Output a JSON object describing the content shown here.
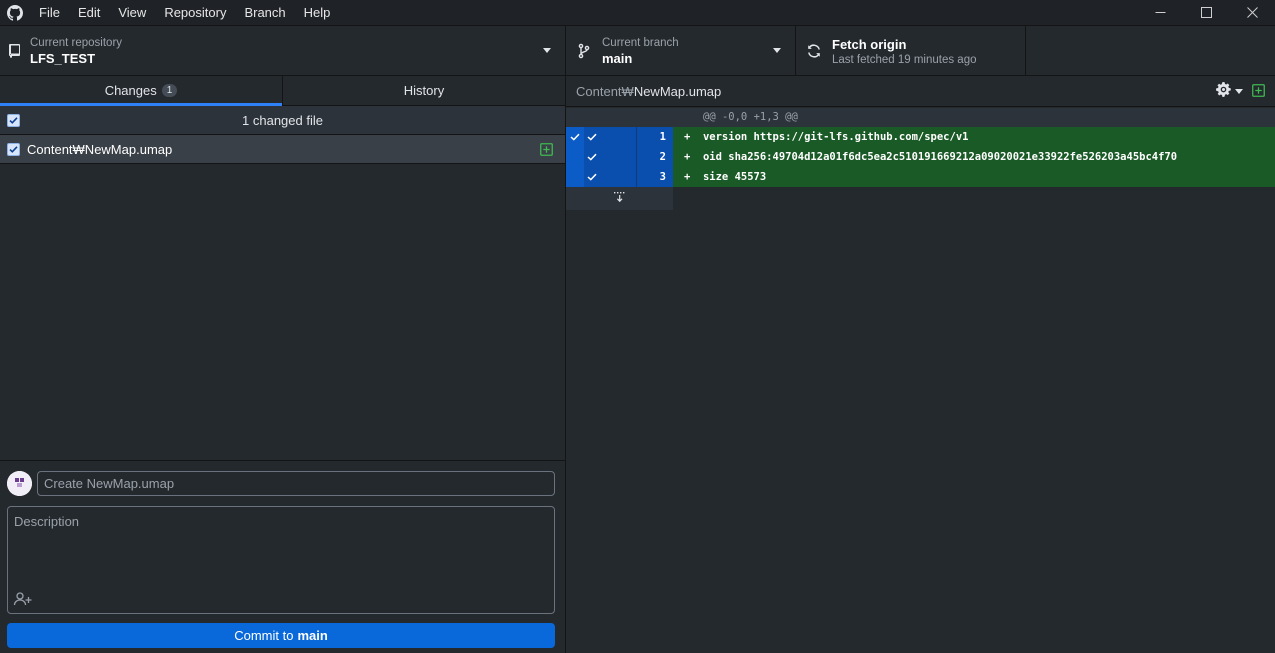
{
  "menu": [
    "File",
    "Edit",
    "View",
    "Repository",
    "Branch",
    "Help"
  ],
  "window_controls": {
    "minimize": "—",
    "maximize": "☐",
    "close": "✕"
  },
  "toolbar": {
    "repo_label": "Current repository",
    "repo_value": "LFS_TEST",
    "branch_label": "Current branch",
    "branch_value": "main",
    "fetch_title": "Fetch origin",
    "fetch_subtitle": "Last fetched 19 minutes ago"
  },
  "tabs": {
    "changes_label": "Changes",
    "changes_count": "1",
    "history_label": "History"
  },
  "changes": {
    "header": "1 changed file",
    "files": [
      {
        "name": "Content₩NewMap.umap"
      }
    ]
  },
  "commit": {
    "summary_placeholder": "Create NewMap.umap",
    "description_placeholder": "Description",
    "button_prefix": "Commit to",
    "button_branch": "main"
  },
  "diff": {
    "path_dir": "Content₩",
    "path_file": "NewMap.umap",
    "hunk_header": "@@ -0,0 +1,3 @@",
    "lines": [
      {
        "num": "1",
        "text": "+  version https://git-lfs.github.com/spec/v1"
      },
      {
        "num": "2",
        "text": "+  oid sha256:49704d12a01f6dc5ea2c510191669212a09020021e33922fe526203a45bc4f70"
      },
      {
        "num": "3",
        "text": "+  size 45573"
      }
    ]
  },
  "colors": {
    "accent": "#2f81f7",
    "commit_button": "#0969da",
    "added_line": "#1a5a26",
    "added_icon": "#3fb950"
  },
  "icons": {
    "app": "github-icon",
    "repo": "repo-icon",
    "branch": "branch-icon",
    "fetch": "sync-icon",
    "settings": "gear-icon",
    "file_added": "plus-square-icon",
    "coauthor": "add-person-icon",
    "expand": "expand-down-icon"
  }
}
